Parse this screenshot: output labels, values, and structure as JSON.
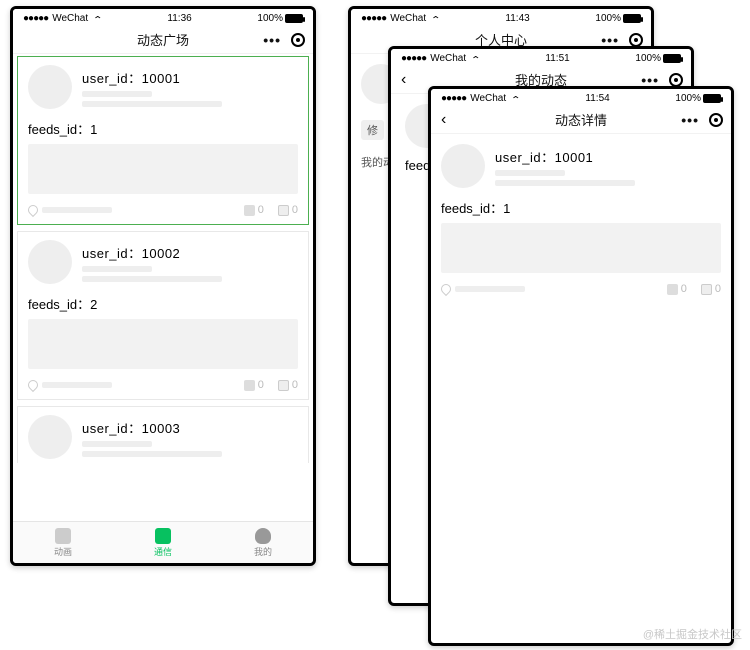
{
  "statusbar": {
    "carrier_dots": "●●●●●",
    "carrier": "WeChat",
    "battery": "100%"
  },
  "capsule": {
    "more": "•••"
  },
  "phone1": {
    "time": "11:36",
    "title": "动态广场",
    "cards": [
      {
        "user_line": "user_id：10001",
        "feeds_line": "feeds_id：1",
        "likes": "0",
        "comments": "0"
      },
      {
        "user_line": "user_id：10002",
        "feeds_line": "feeds_id：2",
        "likes": "0",
        "comments": "0"
      },
      {
        "user_line": "user_id：10003"
      }
    ],
    "tabs": [
      {
        "label": "动画"
      },
      {
        "label": "通信"
      },
      {
        "label": "我的"
      }
    ]
  },
  "phone2": {
    "time": "11:43",
    "title": "个人中心",
    "btn_edit": "修",
    "section": "我的动"
  },
  "phone3": {
    "time": "11:51",
    "title": "我的动态",
    "feeds_partial": "feeds_"
  },
  "phone4": {
    "time": "11:54",
    "title": "动态详情",
    "card": {
      "user_line": "user_id：10001",
      "feeds_line": "feeds_id：1",
      "likes": "0",
      "comments": "0"
    }
  },
  "watermark": "@稀土掘金技术社区"
}
